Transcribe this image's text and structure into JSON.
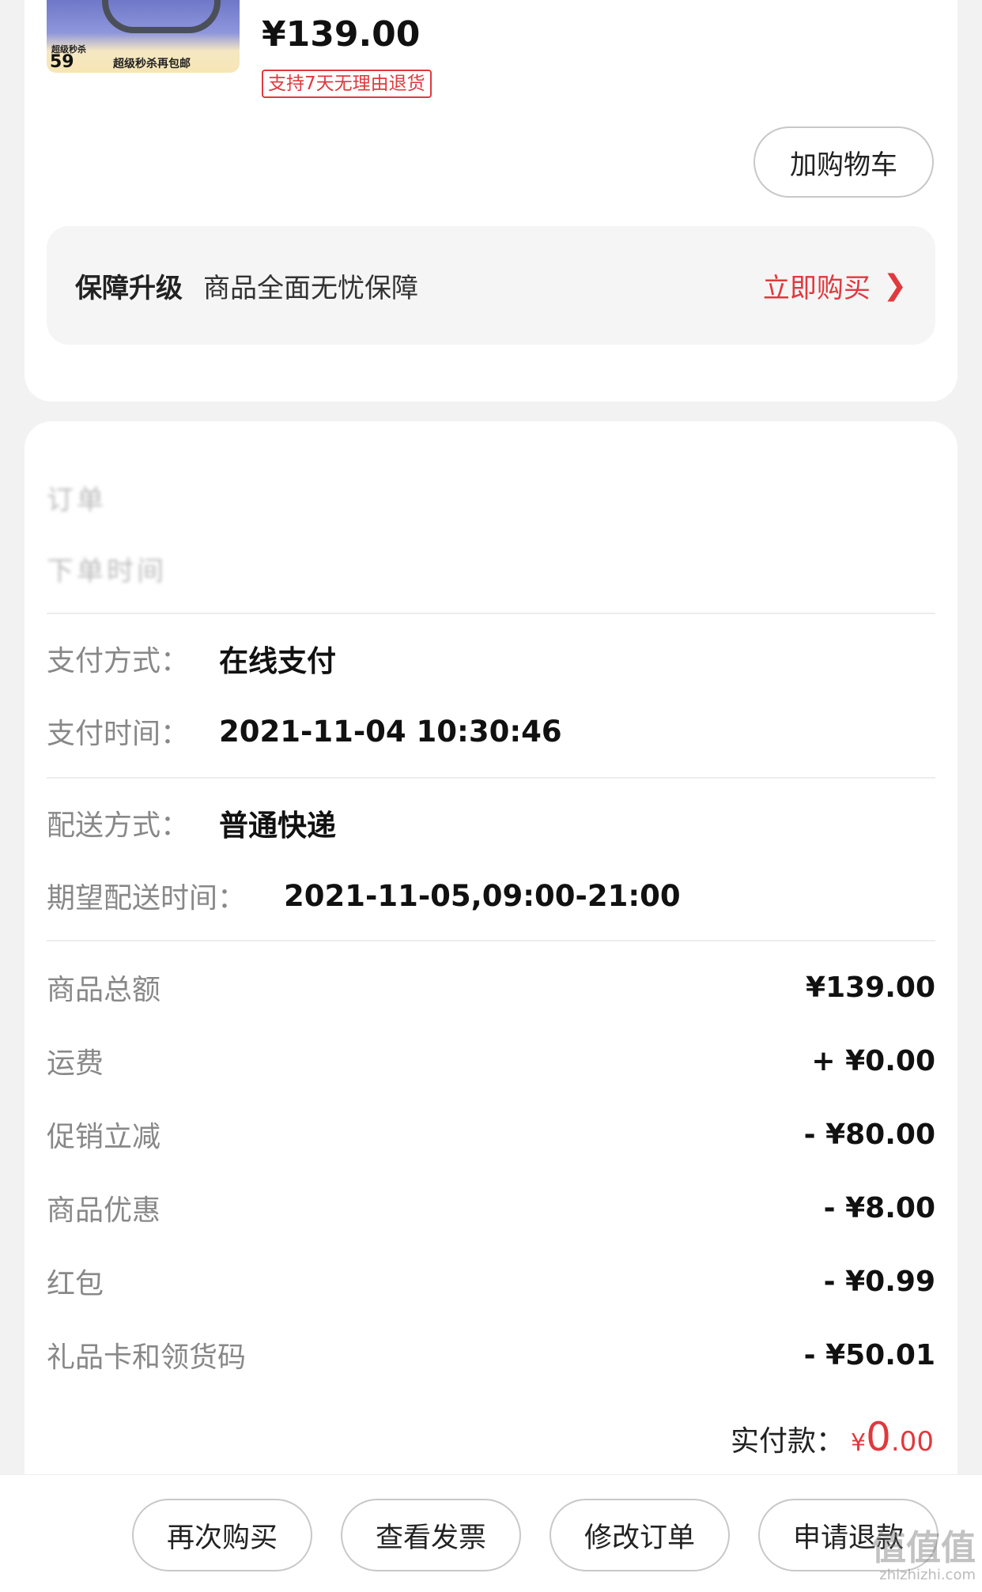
{
  "product": {
    "image_badge_top": "超级秒杀",
    "image_badge_number": "59",
    "image_badge_text": "超级秒杀再包邮",
    "price": "¥139.00",
    "return_policy": "支持7天无理由退货",
    "add_to_cart_label": "加购物车"
  },
  "guarantee": {
    "title": "保障升级",
    "description": "商品全面无忧保障",
    "link_label": "立即购买",
    "chevron_icon": "chevron-right-icon"
  },
  "order": {
    "blurred_row_1": "订单",
    "blurred_row_2": "下单时间",
    "payment_method_label": "支付方式：",
    "payment_method_value": "在线支付",
    "payment_time_label": "支付时间：",
    "payment_time_value": "2021-11-04 10:30:46",
    "delivery_method_label": "配送方式：",
    "delivery_method_value": "普通快递",
    "expected_delivery_label": "期望配送时间：",
    "expected_delivery_value": "2021-11-05,09:00-21:00"
  },
  "amounts": [
    {
      "label": "商品总额",
      "value": "¥139.00"
    },
    {
      "label": "运费",
      "value": "+ ¥0.00"
    },
    {
      "label": "促销立减",
      "value": "- ¥80.00"
    },
    {
      "label": "商品优惠",
      "value": "- ¥8.00"
    },
    {
      "label": "红包",
      "value": "- ¥0.99"
    },
    {
      "label": "礼品卡和领货码",
      "value": "- ¥50.01"
    }
  ],
  "paid": {
    "label": "实付款：",
    "currency": "¥",
    "integer": "0",
    "decimal": ".00"
  },
  "actions": {
    "buy_again": "再次购买",
    "view_invoice": "查看发票",
    "modify_order": "修改订单",
    "request_refund": "申请退款"
  },
  "watermark": {
    "text": "值值值",
    "site": "zhizhizhi.com"
  },
  "colors": {
    "accent": "#e0393e",
    "background": "#f2f2f2"
  }
}
